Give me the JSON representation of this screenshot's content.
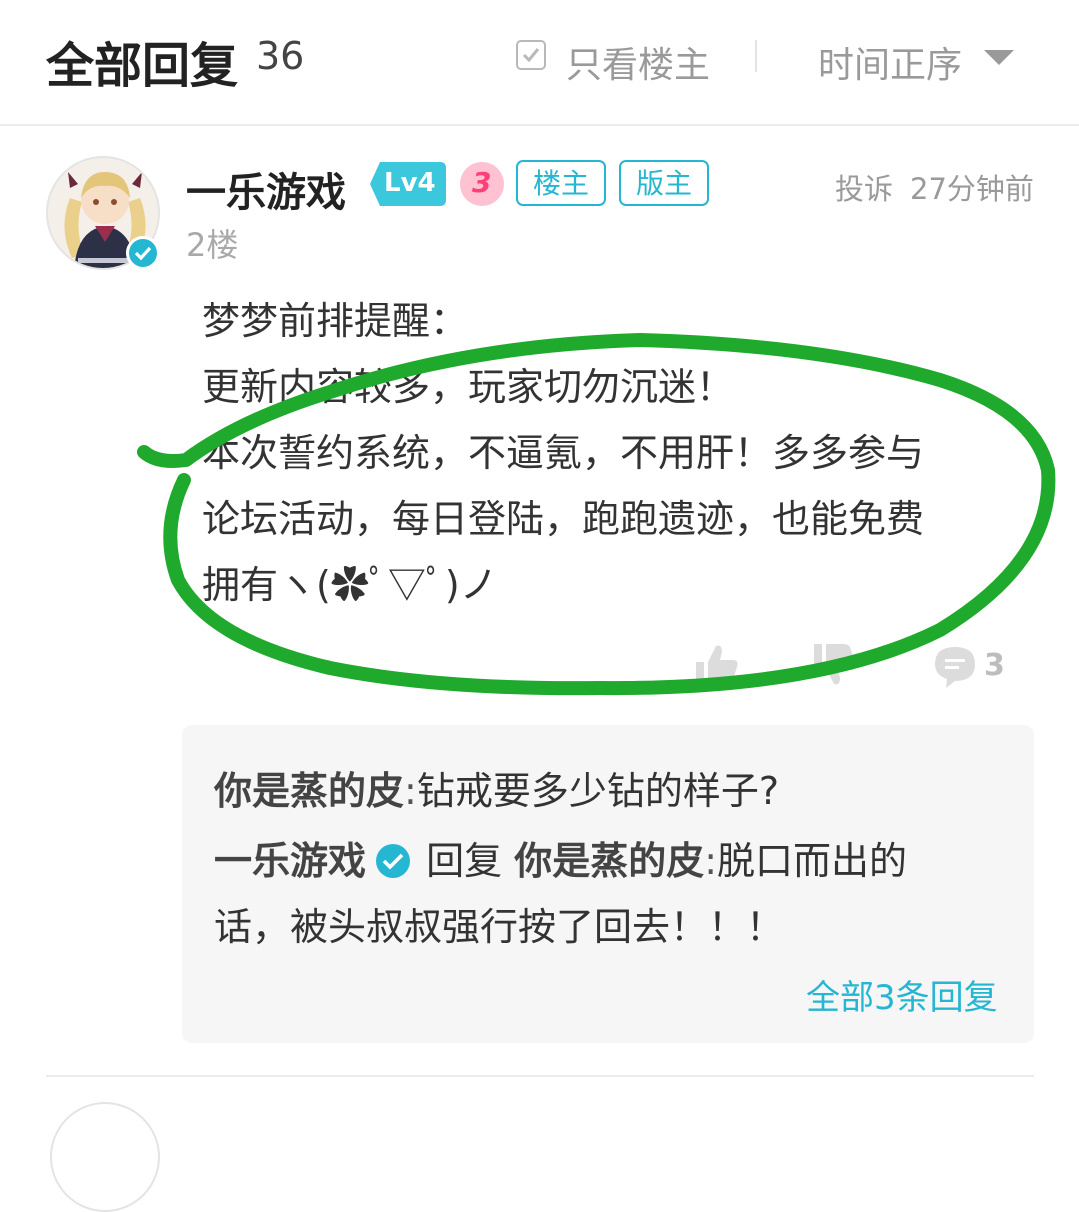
{
  "header": {
    "title": "全部回复",
    "count": "36",
    "only_owner_label": "只看楼主",
    "sort_label": "时间正序",
    "sort_icon": "caret-down-icon"
  },
  "post": {
    "username": "一乐游戏",
    "level": "Lv4",
    "tags": {
      "owner": "楼主",
      "moderator": "版主"
    },
    "report_label": "投诉",
    "time": "27分钟前",
    "floor": "2楼",
    "content_lines": [
      "梦梦前排提醒：",
      "更新内容较多，玩家切勿沉迷！",
      "本次誓约系统，不逼氪，不用肝！多多参与",
      "论坛活动，每日登陆，跑跑遗迹，也能免费",
      "拥有ヽ(✿ﾟ▽ﾟ)ノ"
    ],
    "actions": {
      "like_icon": "thumb-up-icon",
      "dislike_icon": "thumb-down-icon",
      "comment_icon": "comment-icon",
      "comment_count": "3"
    }
  },
  "replies": {
    "items": [
      {
        "author": "你是蒸的皮",
        "text": "钻戒要多少钻的样子?"
      },
      {
        "author": "一乐游戏",
        "reply_word": "回复",
        "target": "你是蒸的皮",
        "text_line1": "脱口而出的",
        "text_line2": "话，被头叔叔强行按了回去！！！"
      }
    ],
    "view_all": "全部3条回复"
  },
  "colors": {
    "accent": "#25b6d2",
    "annotation": "#1faa2d",
    "level_badge": "#3cc8dc",
    "pink_badge": "#ff3f76"
  }
}
